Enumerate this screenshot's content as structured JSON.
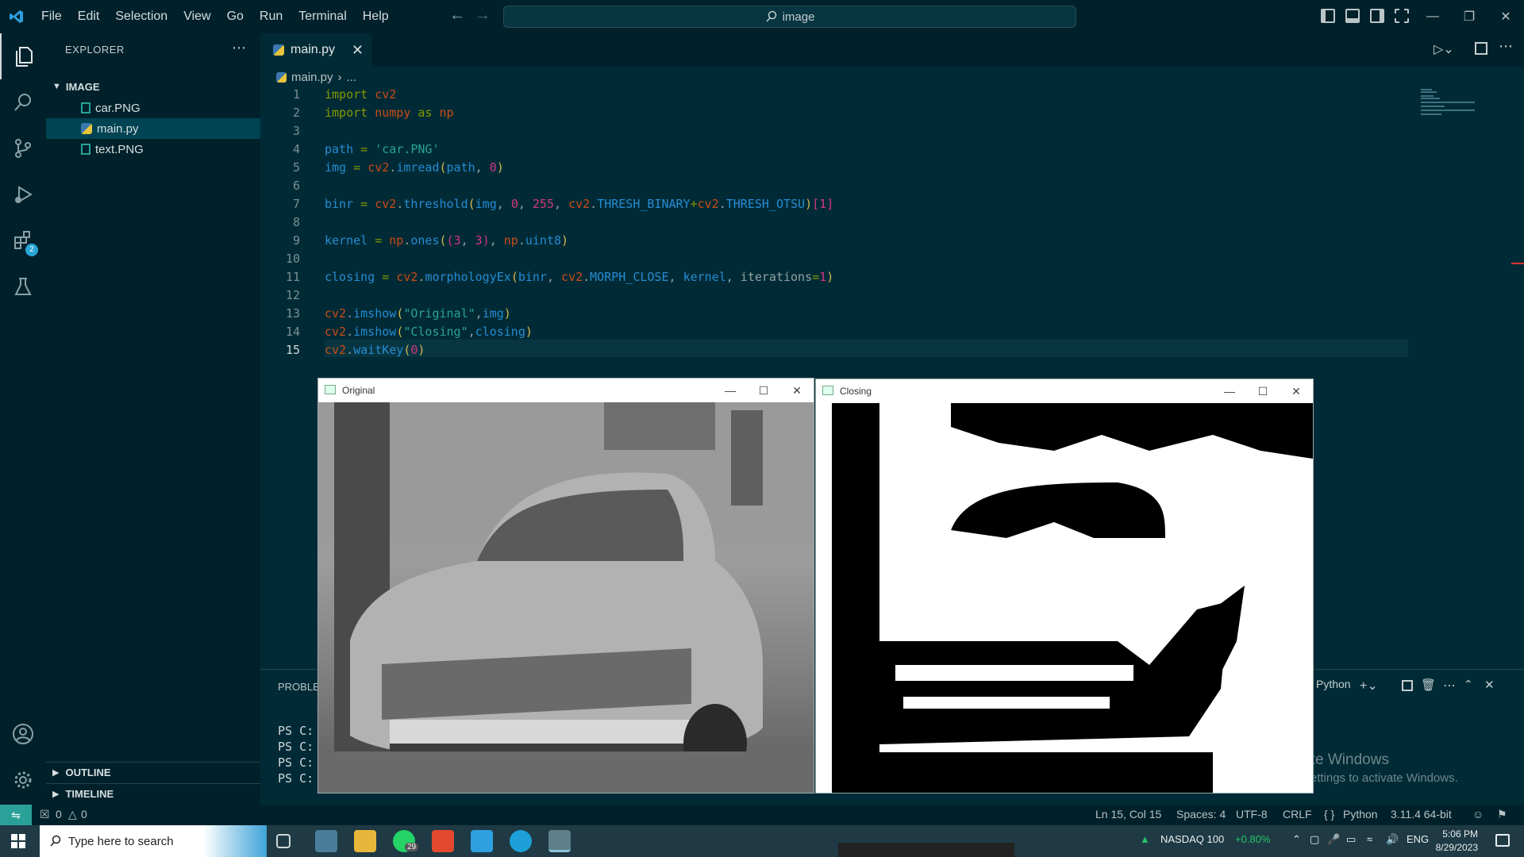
{
  "titlebar": {
    "menu": [
      "File",
      "Edit",
      "Selection",
      "View",
      "Go",
      "Run",
      "Terminal",
      "Help"
    ],
    "search": "image"
  },
  "activity": {
    "extensions_badge": "2"
  },
  "sidebar": {
    "title": "EXPLORER",
    "folder": "IMAGE",
    "files": [
      "car.PNG",
      "main.py",
      "text.PNG"
    ],
    "outline": "OUTLINE",
    "timeline": "TIMELINE"
  },
  "editor": {
    "tab": "main.py",
    "breadcrumb_file": "main.py",
    "breadcrumb_rest": "...",
    "line_numbers": [
      "1",
      "2",
      "3",
      "4",
      "5",
      "6",
      "7",
      "8",
      "9",
      "10",
      "11",
      "12",
      "13",
      "14",
      "15"
    ]
  },
  "windows": {
    "original_title": "Original",
    "closing_title": "Closing"
  },
  "panel": {
    "tab": "PROBLE",
    "lang": "Python",
    "terminal_lines": [
      "PS C:",
      "PS C:",
      "PS C:",
      "PS C:"
    ],
    "activate_title": "Activate Windows",
    "activate_sub": "Go to Settings to activate Windows."
  },
  "statusbar": {
    "errors": "0",
    "warnings": "0",
    "position": "Ln 15, Col 15",
    "spaces": "Spaces: 4",
    "encoding": "UTF-8",
    "eol": "CRLF",
    "language": "Python",
    "interpreter": "3.11.4 64-bit"
  },
  "taskbar": {
    "search_placeholder": "Type here to search",
    "whatsapp_badge": "29",
    "stock_name": "NASDAQ 100",
    "stock_change": "+0.80%",
    "lang": "ENG",
    "time": "5:06 PM",
    "date": "8/29/2023"
  },
  "colors": {
    "editor_bg": "#002b36",
    "keyword": "#859900",
    "string": "#2aa198",
    "number": "#d33682"
  }
}
